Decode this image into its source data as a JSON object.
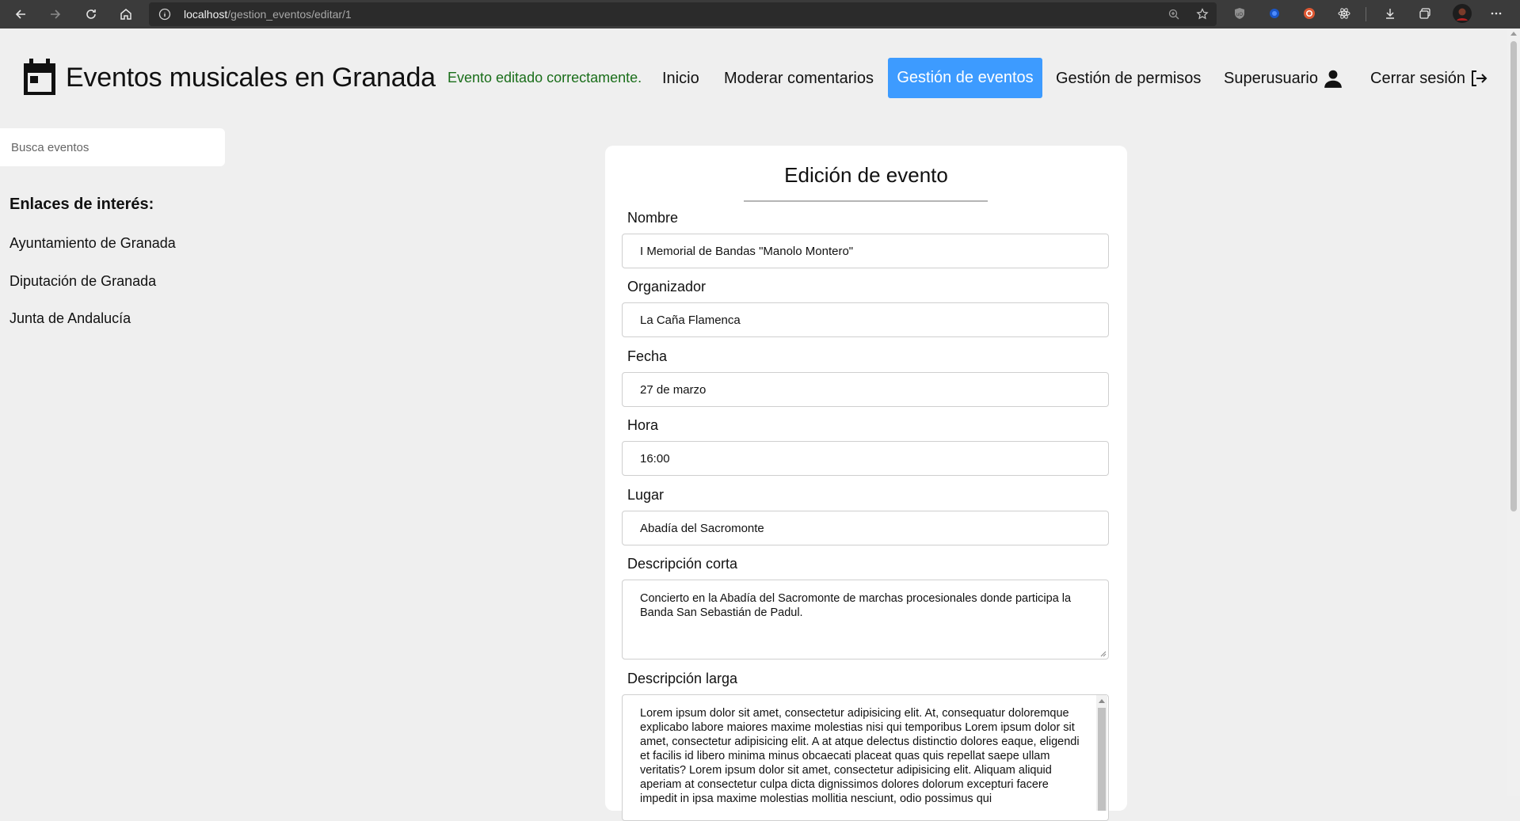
{
  "browser": {
    "url_host": "localhost",
    "url_path": "/gestion_eventos/editar/1"
  },
  "header": {
    "site_title": "Eventos musicales en Granada",
    "status_message": "Evento editado correctamente.",
    "nav": {
      "inicio": "Inicio",
      "moderar": "Moderar comentarios",
      "gestion_eventos": "Gestión de eventos",
      "gestion_permisos": "Gestión de permisos",
      "superusuario": "Superusuario",
      "cerrar_sesion": "Cerrar sesión"
    }
  },
  "sidebar": {
    "search_placeholder": "Busca eventos",
    "links_heading": "Enlaces de interés:",
    "links": [
      "Ayuntamiento de Granada",
      "Diputación de Granada",
      "Junta de Andalucía"
    ]
  },
  "form": {
    "title": "Edición de evento",
    "fields": {
      "nombre": {
        "label": "Nombre",
        "value": "I Memorial de Bandas \"Manolo Montero\""
      },
      "organizador": {
        "label": "Organizador",
        "value": "La Caña Flamenca"
      },
      "fecha": {
        "label": "Fecha",
        "value": "27 de marzo"
      },
      "hora": {
        "label": "Hora",
        "value": "16:00"
      },
      "lugar": {
        "label": "Lugar",
        "value": "Abadía del Sacromonte"
      },
      "descripcion_corta": {
        "label": "Descripción corta",
        "value": "Concierto en la Abadía del Sacromonte de marchas procesionales donde participa la Banda San Sebastián de Padul."
      },
      "descripcion_larga": {
        "label": "Descripción larga",
        "value": "Lorem ipsum dolor sit amet, consectetur adipisicing elit. At, consequatur doloremque explicabo labore maiores maxime molestias nisi qui temporibus Lorem ipsum dolor sit amet, consectetur adipisicing elit. A at atque delectus distinctio dolores eaque, eligendi et facilis id libero minima minus obcaecati placeat quas quis repellat saepe ullam veritatis? Lorem ipsum dolor sit amet, consectetur adipisicing elit. Aliquam aliquid aperiam at consectetur culpa dicta dignissimos dolores dolorum excepturi facere impedit in ipsa maxime molestias mollitia nesciunt, odio possimus qui"
      }
    }
  },
  "colors": {
    "nav_active_bg": "#3d9bff",
    "status_text": "#1a6e1a",
    "page_bg": "#efefef"
  }
}
